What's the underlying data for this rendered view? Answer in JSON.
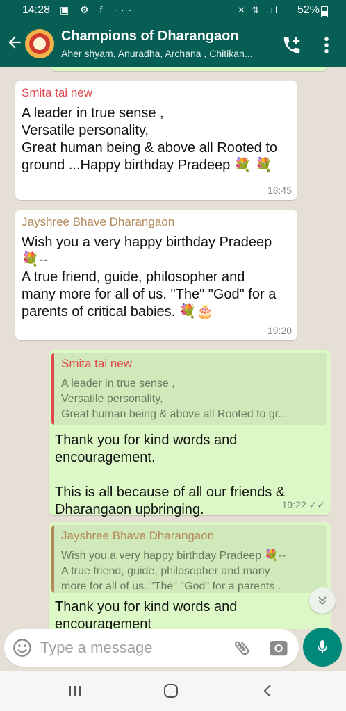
{
  "status": {
    "time": "14:28",
    "left_icons": "▣ ⚙ f ···",
    "right_glyphs": "✕ ⇅ .ıl",
    "battery": "52%"
  },
  "header": {
    "title": "Champions of Dharangaon",
    "subtitle": "Aher shyam, Anuradha, Archana , Chitikan...",
    "avatar": "group-avatar"
  },
  "messages": [
    {
      "sender": "Smita tai new",
      "sender_color": "#e0494f",
      "lines": [
        "A leader in true sense ,",
        "Versatile personality,",
        "Great human being & above all Rooted to",
        "ground ...Happy birthday Pradeep 💐 💐"
      ],
      "time": "18:45"
    },
    {
      "sender": "Jayshree Bhave Dharangaon",
      "sender_color": "#b38a5a",
      "lines": [
        "Wish you a very happy birthday Pradeep",
        "💐--",
        "A true friend, guide, philosopher and",
        "many more for all of us. \"The\" \"God\" for a",
        "parents of critical babies. 💐🎂"
      ],
      "time": "19:20"
    },
    {
      "quote_sender": "Smita tai new",
      "quote_color": "#e0494f",
      "quote_lines": [
        "A leader in true sense ,",
        "Versatile personality,",
        "Great human being & above all Rooted to gr..."
      ],
      "lines": [
        "Thank you for kind words and",
        "encouragement.",
        "",
        "This is all because of all our friends &",
        "Dharangaon upbringing."
      ],
      "time": "19:22 ✓✓"
    },
    {
      "quote_sender": "Jayshree Bhave Dharangaon",
      "quote_color": "#b38a5a",
      "quote_lines": [
        "Wish you a very happy birthday Pradeep 💐--",
        "A true friend, guide, philosopher and many",
        "more for all of us. \"The\" \"God\" for a parents ."
      ],
      "lines": [
        "Thank you for kind words and",
        "encouragement"
      ]
    }
  ],
  "input": {
    "placeholder": "Type a message"
  },
  "colors": {
    "header": "#075e54",
    "incoming": "#ffffff",
    "outgoing": "#dcf8c6",
    "mic_button": "#00897b"
  }
}
